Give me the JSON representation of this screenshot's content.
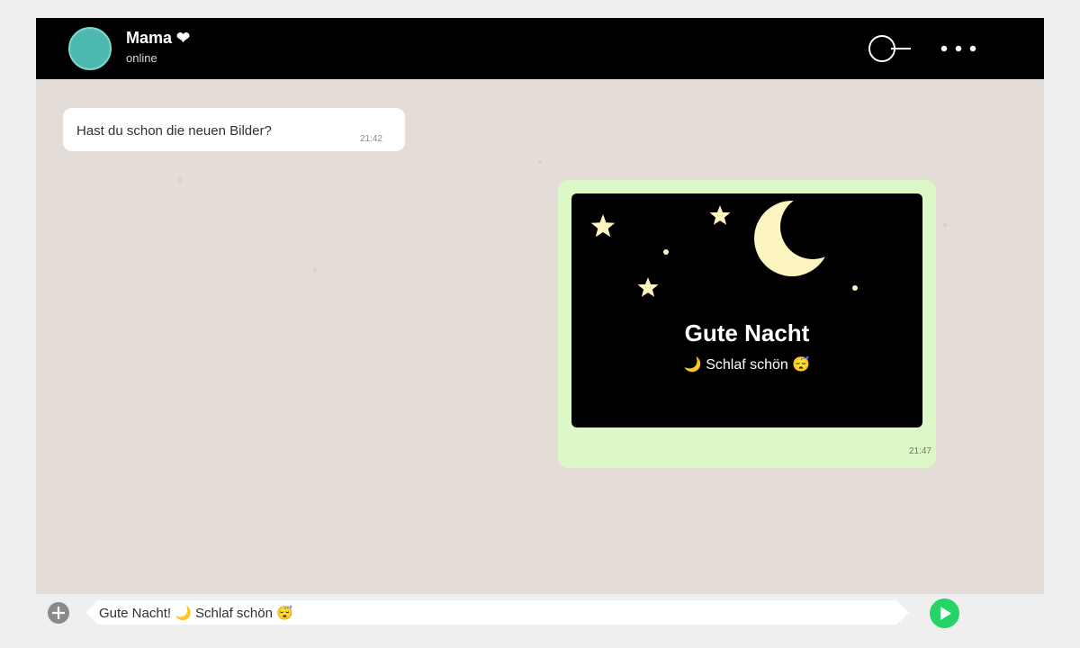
{
  "header": {
    "contact_name": "Mama ❤",
    "contact_status": "online",
    "icons": [
      "search-icon",
      "more-icon"
    ]
  },
  "messages": [
    {
      "direction": "incoming",
      "text": "Hast du schon die neuen Bilder?",
      "time": "21:42"
    },
    {
      "direction": "outgoing",
      "type": "image",
      "image": {
        "title": "Gute Nacht",
        "subtitle": "🌙 Schlaf schön 😴",
        "background_color": "#000000",
        "moon_color": "#fdf5c0",
        "star_color": "#fdf5c0"
      },
      "time": "21:47"
    }
  ],
  "input": {
    "text": "Gute Nacht! 🌙 Schlaf schön 😴"
  },
  "colors": {
    "header_bg": "#000000",
    "chat_bg": "#e4dcd6",
    "incoming_bubble": "#ffffff",
    "outgoing_bubble": "#dcf8c6",
    "send_button": "#25d366",
    "avatar": "#4db8ad"
  }
}
